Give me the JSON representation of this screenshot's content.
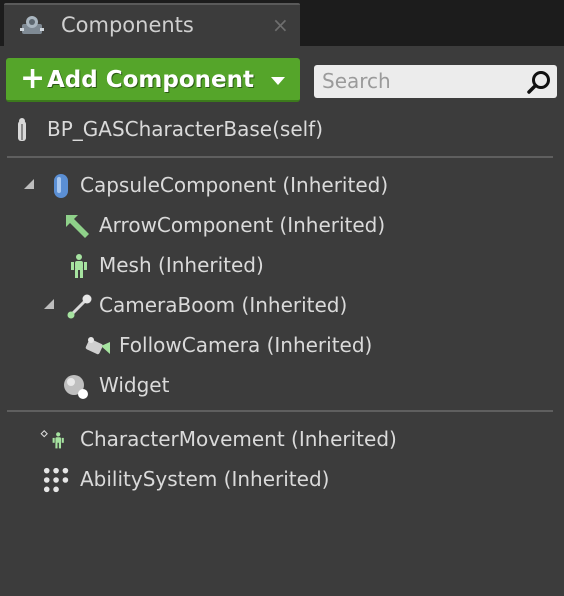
{
  "tab": {
    "title": "Components",
    "close": "×"
  },
  "toolbar": {
    "add_plus": "+",
    "add_label": "Add Component",
    "search_placeholder": "Search"
  },
  "root": {
    "label": "BP_GASCharacterBase(self)"
  },
  "tree": [
    {
      "label": "CapsuleComponent (Inherited)",
      "icon": "capsule-icon",
      "expanded": true
    },
    {
      "label": "ArrowComponent (Inherited)",
      "icon": "arrow-icon"
    },
    {
      "label": "Mesh (Inherited)",
      "icon": "mesh-icon"
    },
    {
      "label": "CameraBoom (Inherited)",
      "icon": "camera-boom-icon",
      "expanded": true
    },
    {
      "label": "FollowCamera (Inherited)",
      "icon": "camera-icon"
    },
    {
      "label": "Widget",
      "icon": "widget-icon"
    }
  ],
  "actors": [
    {
      "label": "CharacterMovement (Inherited)",
      "icon": "character-movement-icon"
    },
    {
      "label": "AbilitySystem (Inherited)",
      "icon": "ability-system-icon"
    }
  ],
  "colors": {
    "add_button": "#55a52a",
    "panel": "#3c3c3c",
    "text": "#dadada"
  }
}
